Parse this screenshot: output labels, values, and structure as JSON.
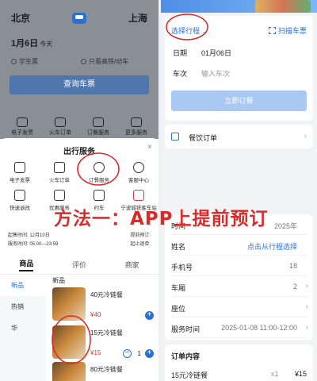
{
  "left": {
    "from_city": "北京",
    "to_city": "上海",
    "date": "1月6日",
    "date_suffix": "今天",
    "option_student": "学生票",
    "option_high_speed": "只看高铁/动车",
    "query_button": "查询车票",
    "note": "",
    "quick_items": [
      "电子发票",
      "火车订单",
      "订餐服务",
      "更多服务"
    ],
    "sheet_title": "出行服务",
    "sheet_close": "×",
    "services": [
      "电子发票",
      "火车订单",
      "订餐服务",
      "客服中心",
      "快速退改",
      "优惠服务",
      "约车",
      "宁波城铁客车站"
    ],
    "info_depart_label": "起售时间:",
    "info_depart_value": "12月10日",
    "info_service_label": "服务时间:",
    "info_service_value": "05:00—23:59",
    "info_delivery_label": "提前预订:",
    "info_delivery_value": "",
    "info_refund_label": "起止退单:",
    "info_refund_value": "",
    "tabs": [
      "商品",
      "评价",
      "商家"
    ],
    "categories": [
      "新品",
      "热销",
      "华"
    ],
    "section_header": "新品",
    "products": [
      {
        "name": "40元冷链餐",
        "price": "¥40"
      },
      {
        "name": "15元冷链餐",
        "price": "¥15",
        "qty": "1"
      },
      {
        "name": "80元冷链餐",
        "price": ""
      }
    ],
    "minus": "−",
    "plus": "+"
  },
  "right": {
    "banner_text": "",
    "select_trip": "选择行程",
    "scan_ticket": "扫描车票",
    "date_label": "日期",
    "date_value": "01月06日",
    "train_label": "车次",
    "train_placeholder": "输入车次",
    "order_button": "立即订餐",
    "catering_order": "餐饮订单",
    "form": {
      "time_label": "时间",
      "time_value": "2025年",
      "name_label": "姓名",
      "name_value": "点击从行程选择",
      "phone_label": "手机号",
      "phone_value": "18",
      "car_label": "车厢",
      "car_value": "2",
      "seat_label": "座位",
      "seat_value": "",
      "service_time_label": "服务时间",
      "service_time_value": "2025-01-08 11:00-12:00"
    },
    "content_title": "订单内容",
    "content_item": "15元冷链餐",
    "content_count": "x1",
    "content_price": "¥15"
  },
  "overlay_caption": "方法一：APP上提前预订",
  "colors": {
    "brand_blue": "#2a6fd6",
    "annotation_red": "#d82c2c",
    "price_red": "#e0342c"
  }
}
